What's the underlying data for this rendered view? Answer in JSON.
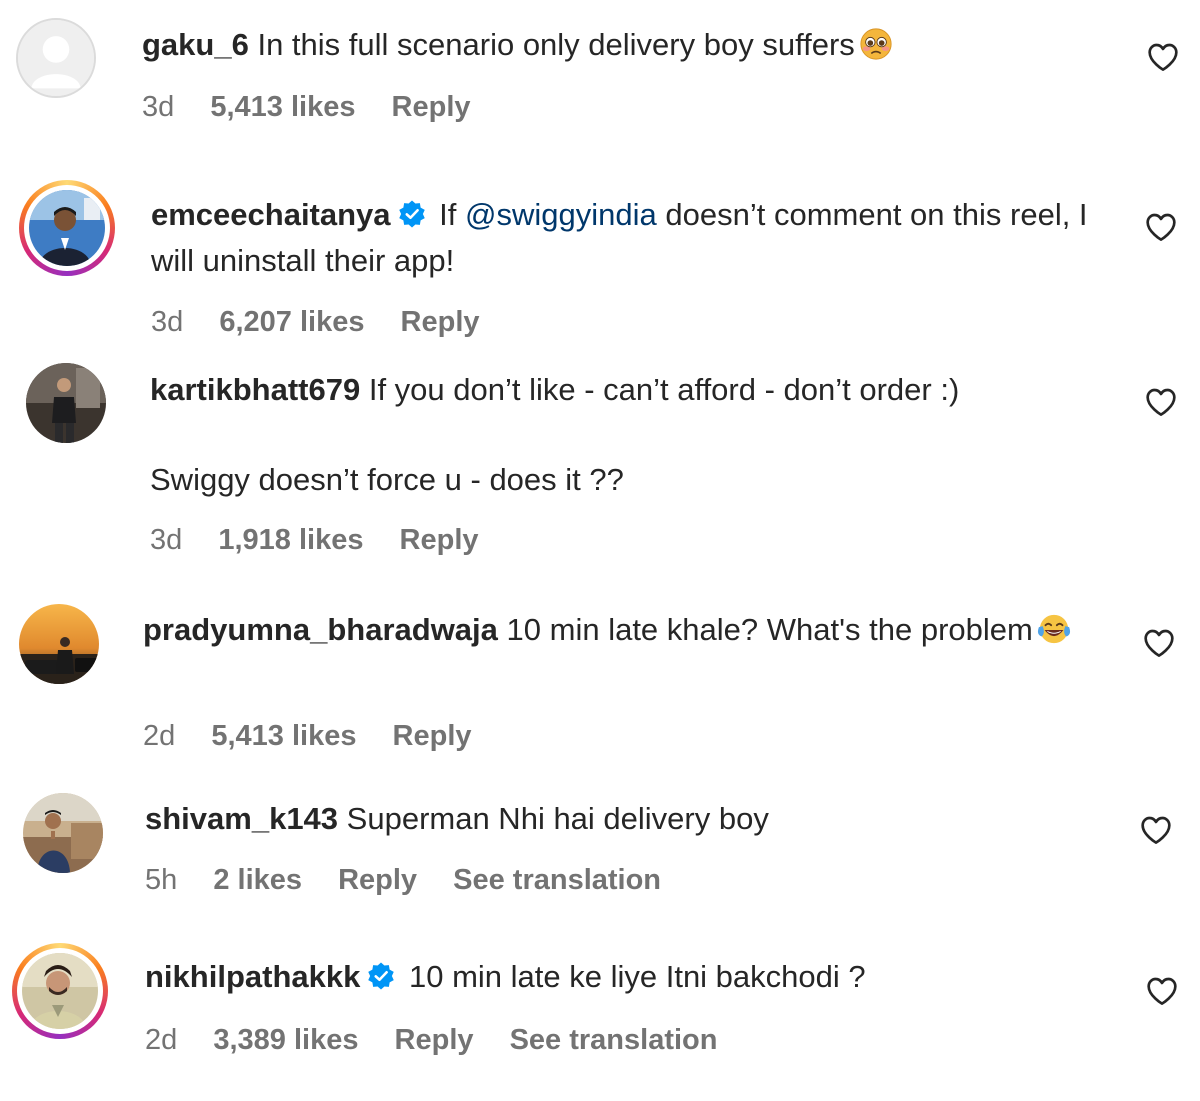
{
  "comments": [
    {
      "username": "gaku_6",
      "verified": false,
      "text": "In this full scenario only delivery boy suffers",
      "emoji": "pleading-face-emoji",
      "time": "3d",
      "likes": "5,413 likes",
      "reply": "Reply"
    },
    {
      "username": "emceechaitanya",
      "verified": true,
      "text_before": "If",
      "mention": "@swiggyindia",
      "text_after": "doesn’t comment on this reel, I will uninstall their app!",
      "time": "3d",
      "likes": "6,207 likes",
      "reply": "Reply"
    },
    {
      "username": "kartikbhatt679",
      "verified": false,
      "text": "If you don’t like - can’t afford - don’t order :)",
      "text_line2": "Swiggy doesn’t force u - does it ??",
      "time": "3d",
      "likes": "1,918 likes",
      "reply": "Reply"
    },
    {
      "username": "pradyumna_bharadwaja",
      "verified": false,
      "text": "10 min late khale? What's the problem",
      "emoji": "laughing-tears-emoji",
      "time": "2d",
      "likes": "5,413 likes",
      "reply": "Reply"
    },
    {
      "username": "shivam_k143",
      "verified": false,
      "text": "Superman Nhi hai delivery boy",
      "time": "5h",
      "likes": "2 likes",
      "reply": "Reply",
      "translation": "See translation"
    },
    {
      "username": "nikhilpathakkk",
      "verified": true,
      "text": "10 min late ke liye Itni bakchodi ?",
      "time": "2d",
      "likes": "3,389 likes",
      "reply": "Reply",
      "translation": "See translation"
    }
  ],
  "colors": {
    "text": "#262626",
    "secondary": "#737373",
    "mention": "#00376b",
    "verified": "#0095f6"
  },
  "icons": {
    "like": "heart-outline-icon",
    "verified": "verified-badge-icon"
  }
}
